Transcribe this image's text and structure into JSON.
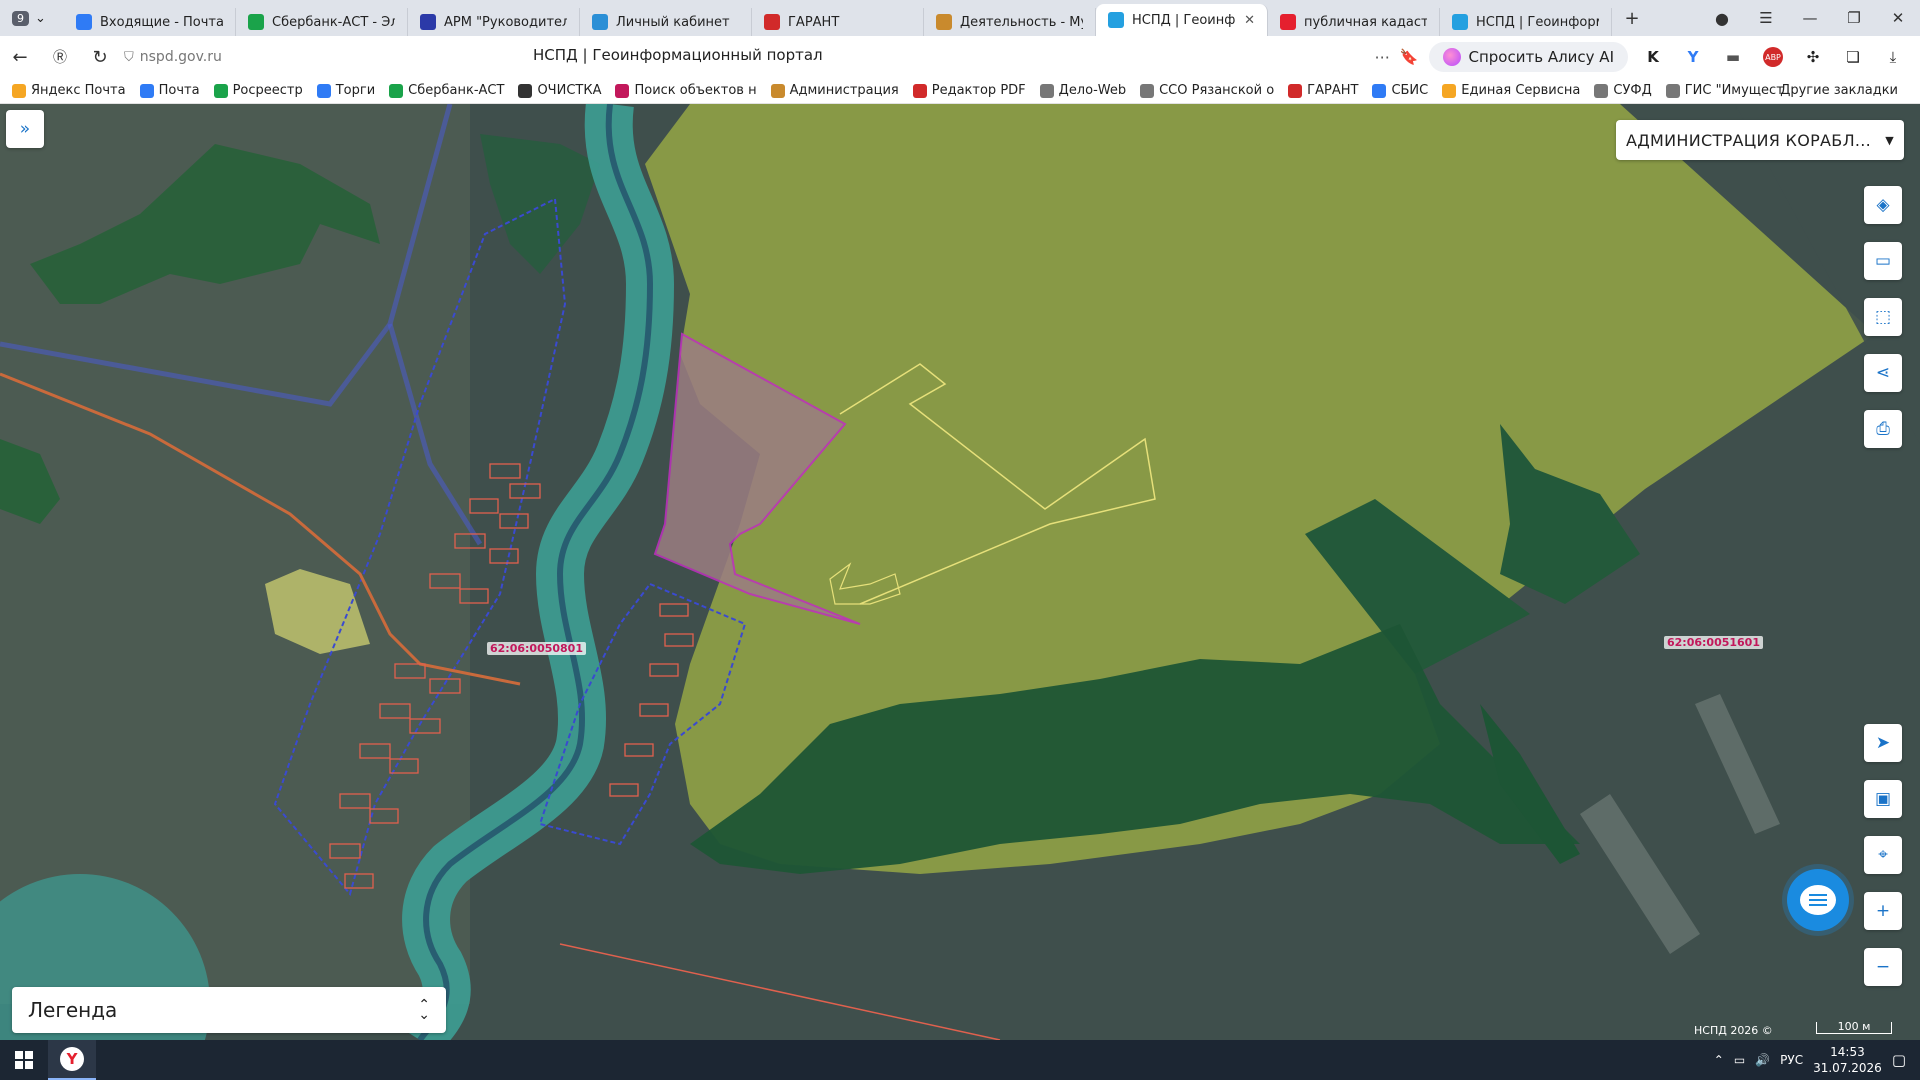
{
  "browser": {
    "tab_count": "9",
    "tabs": [
      {
        "label": "Входящие - Почта",
        "color": "#2f7bf5",
        "icon": "mail-icon"
      },
      {
        "label": "Сбербанк-АСТ - Элект",
        "color": "#1aa34a",
        "icon": "sberbank-icon"
      },
      {
        "label": "АРМ \"Руководитель",
        "color": "#2b3aa8",
        "icon": "arm-icon"
      },
      {
        "label": "Личный кабинет",
        "color": "#2b8fd6",
        "icon": "cabinet-icon"
      },
      {
        "label": "ГАРАНТ",
        "color": "#d12a2a",
        "icon": "garant-icon"
      },
      {
        "label": "Деятельность - Муни",
        "color": "#c98a2d",
        "icon": "coat-of-arms-icon"
      },
      {
        "label": "НСПД | Геоинфор",
        "color": "#24a0e0",
        "icon": "nspd-icon",
        "active": true
      },
      {
        "label": "публичная кадастро",
        "color": "#e5202e",
        "icon": "yandex-icon"
      },
      {
        "label": "НСПД | Геоинформа",
        "color": "#24a0e0",
        "icon": "nspd-icon"
      }
    ],
    "url": "nspd.gov.ru",
    "page_title": "НСПД | Геоинформационный портал",
    "alisa_label": "Спросить Алису AI",
    "bookmarks": [
      {
        "label": "Яндекс Почта",
        "color": "#f5a623"
      },
      {
        "label": "Почта",
        "color": "#2f7bf5"
      },
      {
        "label": "Росреестр",
        "color": "#1aa34a"
      },
      {
        "label": "Торги",
        "color": "#2f7bf5"
      },
      {
        "label": "Сбербанк-АСТ",
        "color": "#1aa34a"
      },
      {
        "label": "ОЧИСТКА",
        "color": "#333333"
      },
      {
        "label": "Поиск объектов н",
        "color": "#c2185b"
      },
      {
        "label": "Администрация",
        "color": "#c98a2d"
      },
      {
        "label": "Редактор PDF",
        "color": "#d12a2a"
      },
      {
        "label": "Дело-Web",
        "color": "#777777"
      },
      {
        "label": "ССО Рязанской о",
        "color": "#777777"
      },
      {
        "label": "ГАРАНТ",
        "color": "#d12a2a"
      },
      {
        "label": "СБИС",
        "color": "#2f7bf5"
      },
      {
        "label": "Единая Сервисна",
        "color": "#f5a623"
      },
      {
        "label": "СУФД",
        "color": "#777777"
      },
      {
        "label": "ГИС \"Имущест",
        "color": "#777777"
      }
    ],
    "other_bookmarks": "Другие закладки"
  },
  "map": {
    "admin_select": "АДМИНИСТРАЦИЯ КОРАБЛ...",
    "legend_label": "Легенда",
    "cadastral_labels": [
      "62:06:0050801",
      "62:06:0051601"
    ],
    "copyright": "НСПД 2026 ©",
    "scale": "100 м"
  },
  "taskbar": {
    "lang": "РУС",
    "time": "14:53",
    "date": "31.07.2026"
  }
}
